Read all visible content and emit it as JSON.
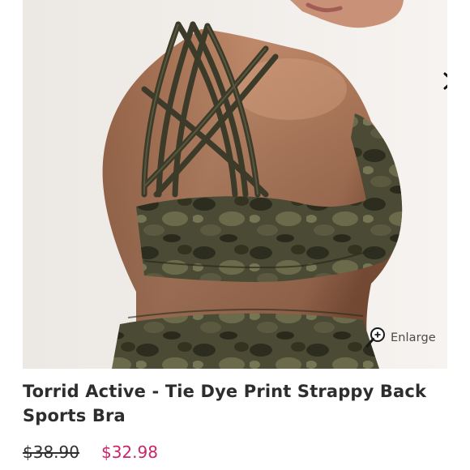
{
  "product": {
    "title": "Torrid Active - Tie Dye Print Strappy Back Sports Bra",
    "price_original": "$38.90",
    "price_sale": "$32.98",
    "colors": {
      "sale_price": "#c8266b",
      "title_text": "#2d2d2d",
      "strikethrough_price": "#2f2f2f"
    }
  },
  "gallery": {
    "enlarge_label": "Enlarge",
    "enlarge_icon": "magnifier-plus-icon",
    "next_icon": "chevron-right-icon"
  }
}
